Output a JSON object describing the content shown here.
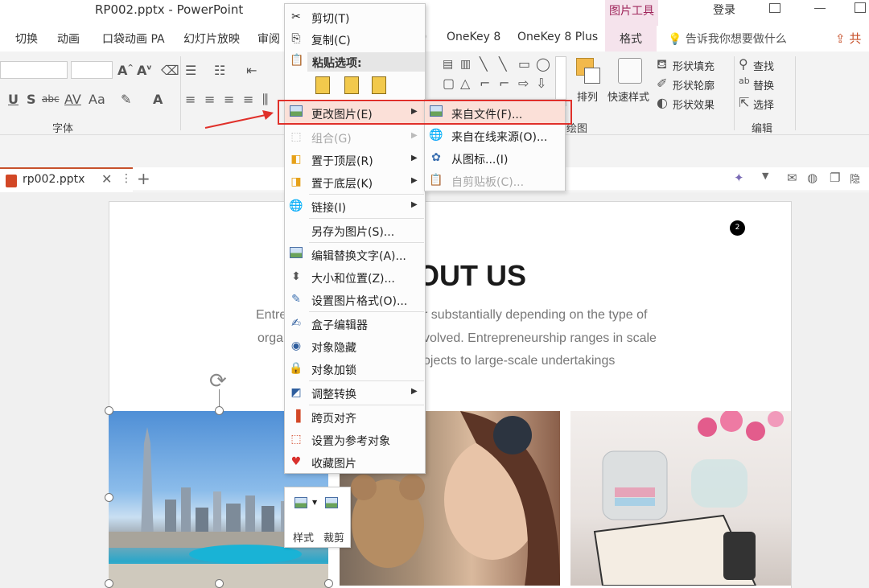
{
  "title_bar": {
    "title": "RP002.pptx  -  PowerPoint",
    "tool_group": "图片工具",
    "login": "登录"
  },
  "ribbon_tabs": [
    {
      "label": "切换"
    },
    {
      "label": "动画"
    },
    {
      "label": "口袋动画 PA"
    },
    {
      "label": "幻灯片放映"
    },
    {
      "label": "审阅"
    },
    {
      "label": ")"
    },
    {
      "label": "OneKey 8"
    },
    {
      "label": "OneKey 8 Plus"
    },
    {
      "label": "格式"
    }
  ],
  "tell_me": "告诉我你想要做什么",
  "share_label": "共",
  "ribbon": {
    "font_group_label": "字体",
    "drawing_group_label": "绘图",
    "editing_group_label": "编辑",
    "arrange_label": "排列",
    "quick_style_label": "快速样式",
    "shape_fill": "形状填充",
    "shape_outline": "形状轮廓",
    "shape_effects": "形状效果",
    "find": "查找",
    "replace": "替换",
    "select": "选择",
    "font_buttons": [
      "U",
      "S",
      "abc",
      "AV",
      "Aa"
    ]
  },
  "document_tab": {
    "name": "rp002.pptx",
    "close": "✕",
    "more": "⋮",
    "add": "+"
  },
  "slide": {
    "heading": "OUT US",
    "badge": "2",
    "body_lines": [
      {
        "left": "Entre",
        "right": "r substantially depending on the type of"
      },
      {
        "left": "orga",
        "right": "volved. Entrepreneurship ranges in scale"
      },
      {
        "left": "",
        "right": "ojects to large-scale undertakings"
      }
    ]
  },
  "context_menu": {
    "items": [
      {
        "label": "剪切(T)",
        "icon": "scissors-icon"
      },
      {
        "label": "复制(C)",
        "icon": "copy-icon"
      },
      {
        "label": "粘贴选项:",
        "icon": "paste-icon"
      },
      {
        "label": "更改图片(E)",
        "icon": "change-picture-icon",
        "highlighted": true,
        "submenu": true
      },
      {
        "label": "组合(G)",
        "icon": "group-icon",
        "disabled": true,
        "submenu": true
      },
      {
        "label": "置于顶层(R)",
        "icon": "bring-to-front-icon",
        "submenu": true
      },
      {
        "label": "置于底层(K)",
        "icon": "send-to-back-icon",
        "submenu": true
      },
      {
        "label": "链接(I)",
        "icon": "link-icon",
        "submenu": true
      },
      {
        "label": "另存为图片(S)...",
        "icon": ""
      },
      {
        "label": "编辑替换文字(A)...",
        "icon": "alt-text-icon"
      },
      {
        "label": "大小和位置(Z)...",
        "icon": "size-position-icon"
      },
      {
        "label": "设置图片格式(O)...",
        "icon": "format-picture-icon"
      },
      {
        "label": "盒子编辑器",
        "icon": "box-editor-icon"
      },
      {
        "label": "对象隐藏",
        "icon": "hide-object-icon"
      },
      {
        "label": "对象加锁",
        "icon": "lock-icon"
      },
      {
        "label": "调整转换",
        "icon": "convert-icon",
        "submenu": true
      },
      {
        "label": "跨页对齐",
        "icon": "align-pages-icon"
      },
      {
        "label": "设置为参考对象",
        "icon": "reference-object-icon"
      },
      {
        "label": "收藏图片",
        "icon": "heart-icon"
      }
    ]
  },
  "submenu": {
    "items": [
      {
        "label": "来自文件(F)...",
        "highlighted": true
      },
      {
        "label": "来自在线来源(O)..."
      },
      {
        "label": "从图标...(I)"
      },
      {
        "label": "自剪贴板(C)...",
        "disabled": true
      }
    ]
  },
  "mini_toolbar": {
    "style_label": "样式",
    "crop_label": "裁剪"
  },
  "colors": {
    "accent": "#c7512b",
    "picture_tools_tab": "#f5e3ec",
    "highlight": "#fbe0d8",
    "red_annotation": "#e0302a"
  }
}
